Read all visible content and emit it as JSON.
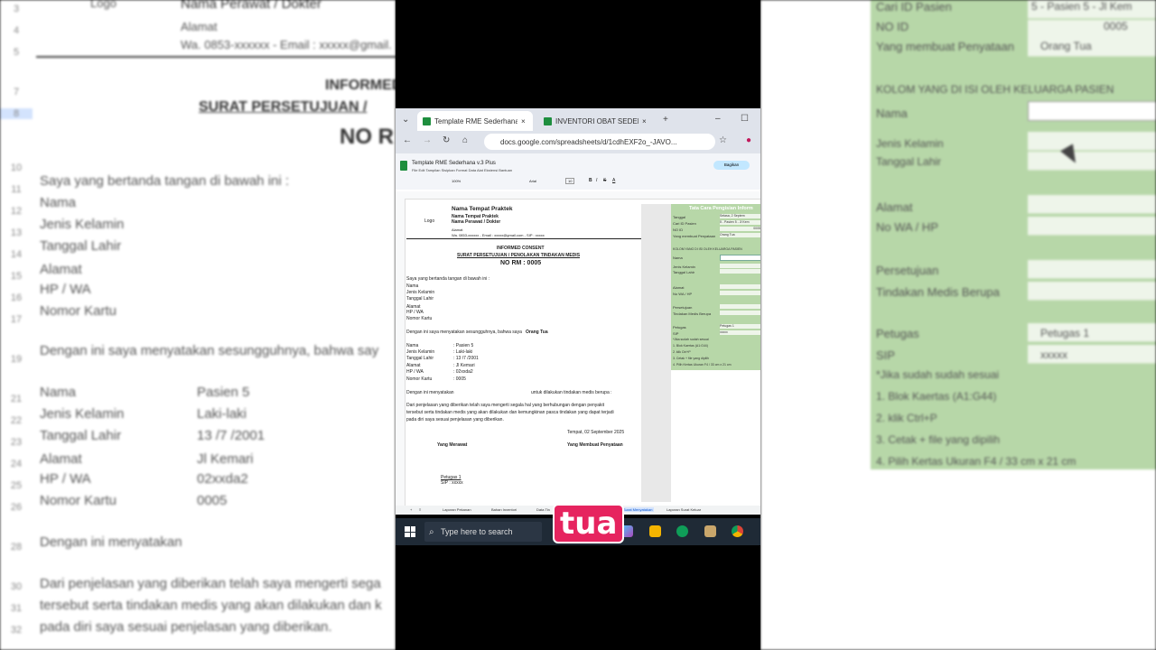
{
  "browser": {
    "tabs": [
      {
        "title": "Template RME Sederhana v.3"
      },
      {
        "title": "INVENTORI OBAT SEDERHA"
      }
    ],
    "url": "docs.google.com/spreadsheets/d/1cdhEXF2o_-JAVO..."
  },
  "sheet": {
    "doc_title": "Template RME Sederhana v.3 Plus",
    "menu": "File  Edit  Tampilan  Sisipkan  Format  Data  Alat  Ekstensi  Bantuan",
    "share_label": "Bagikan",
    "zoom": "100%",
    "font": "Arial",
    "font_size": "10",
    "header": {
      "practice_name": "Nama Tempat Praktek",
      "practice_name_2": "Nama Tempat Praktek",
      "staff": "Nama Perawat / Dokter",
      "address": "Alamat",
      "contact": "Wa. 0853-xxxxxx - Email : xxxxx@gmail.com - SIP : xxxxx",
      "logo": "Logo"
    },
    "consent": {
      "title": "INFORMED CONSENT",
      "subtitle": "SURAT PERSETUJUAN / PENOLAKAN TINDAKAN MEDIS",
      "no_rm": "NO RM : 0005",
      "signer_intro": "Saya yang bertanda tangan di bawah ini :",
      "fields": [
        "Nama",
        "Jenis Kelamin",
        "Tanggal Lahir",
        "Alamat",
        "HP / WA",
        "Nomor Kartu"
      ],
      "statement": "Dengan ini saya menyatakan sesungguhnya, bahwa saya",
      "relation": "Orang Tua",
      "patient": [
        {
          "label": "Nama",
          "value": ": Pasien 5"
        },
        {
          "label": "Jenis Kelamin",
          "value": ": Laki-laki"
        },
        {
          "label": "Tanggal Lahir",
          "value": ": 13 /7 /2001"
        },
        {
          "label": "Alamat",
          "value": ": Jl Kemari"
        },
        {
          "label": "HP / WA",
          "value": ": 02xxda2"
        },
        {
          "label": "Nomor Kartu",
          "value": ": 0005"
        }
      ],
      "declare": "Dengan ini menyatakan",
      "declare_2": "untuk dilakukan tindakan medis berupa :",
      "explanation_1": "Dari penjelasan yang diberikan telah saya mengerti segala hal yang berhubungan dengan penyakit",
      "explanation_2": "tersebut serta tindakan medis yang akan dilakukan dan kemungkinan pasca tindakan yang dapat terjadi",
      "explanation_3": "pada diri saya sesuai penjelasan yang diberikan.",
      "place_date": "Tempat, 02 September 2025",
      "sign_left": "Yang Merawat",
      "sign_right": "Yang Membuat Penyataan",
      "officer": "Petugas 1",
      "sip": "SIP : xxxxx"
    },
    "panel": {
      "title": "Tata Cara Pengisian Inform",
      "rows": [
        {
          "label": "Tanggal",
          "value": "Selasa, 2 Septem"
        },
        {
          "label": "Cari ID Pasien",
          "value": "5 - Pasien 5 - Jl Kem"
        },
        {
          "label": "NO ID",
          "value": "0005"
        },
        {
          "label": "Yang membuat Penyataan",
          "value": "Orang Tua"
        }
      ],
      "family_header": "KOLOM YANG DI ISI OLEH KELUARGA PASIEN",
      "family_fields": [
        "Nama",
        "Jenis Kelamin",
        "Tanggal Lahir",
        "Alamat",
        "No WA / HP",
        "Persetujuan",
        "Tindakan Medis Berupa"
      ],
      "officer_label": "Petugas",
      "officer_value": "Petugas 1",
      "sip_label": "SIP",
      "sip_value": "xxxxx",
      "notes": [
        "*Jika sudah sudah sesuai",
        "1. Blok Kaertas (A1:G44)",
        "2. klik Ctrl+P",
        "3. Cetak + file yang dipilih",
        "4. Pilih Kertas Ukuran F4 / 33 cm x 21 cm"
      ]
    },
    "tabs": [
      "Laporan Pekanan",
      "Bahan Inventori",
      "Data Tin",
      "Surat Menyatakan",
      "Laporan Surat Keluar"
    ]
  },
  "taskbar": {
    "search_placeholder": "Type here to search"
  },
  "caption": "tua",
  "background_left": {
    "logo": "Logo",
    "staff": "Nama Perawat / Dokter",
    "address": "Alamat",
    "contact": "Wa. 0853-xxxxxx - Email : xxxxx@gmail.",
    "title": "INFORMED",
    "subtitle": "SURAT PERSETUJUAN /",
    "no_rm": "NO R",
    "signer_intro": "Saya yang bertanda tangan di bawah ini :",
    "fields": [
      "Nama",
      "Jenis Kelamin",
      "Tanggal Lahir",
      "Alamat",
      "HP / WA",
      "Nomor Kartu"
    ],
    "statement": "Dengan ini saya menyatakan sesungguhnya, bahwa say",
    "patient": [
      {
        "label": "Nama",
        "value": "Pasien 5"
      },
      {
        "label": "Jenis Kelamin",
        "value": "Laki-laki"
      },
      {
        "label": "Tanggal Lahir",
        "value": "13 /7 /2001"
      },
      {
        "label": "Alamat",
        "value": "Jl Kemari"
      },
      {
        "label": "HP / WA",
        "value": "02xxda2"
      },
      {
        "label": "Nomor Kartu",
        "value": "0005"
      }
    ],
    "declare": "Dengan ini menyatakan",
    "explanation_1": "Dari penjelasan yang diberikan telah saya mengerti sega",
    "explanation_2": "tersebut serta tindakan medis yang akan dilakukan dan k",
    "explanation_3": "pada diri saya sesuai penjelasan yang diberikan."
  },
  "background_right": {
    "rows": [
      "Cari ID Pasien",
      "NO ID",
      "Yang membuat Penyataan"
    ],
    "values": [
      "5 - Pasien 5 - Jl Kem",
      "0005",
      "Orang Tua"
    ],
    "family_header": "KOLOM YANG DI ISI OLEH KELUARGA PASIEN",
    "family_fields": [
      "Nama",
      "Jenis Kelamin",
      "Tanggal Lahir",
      "Alamat",
      "No WA / HP",
      "Persetujuan",
      "Tindakan Medis Berupa"
    ],
    "officer_label": "Petugas",
    "officer_value": "Petugas 1",
    "sip_label": "SIP",
    "sip_value": "xxxxx",
    "notes": [
      "*Jika sudah sudah sesuai",
      "1. Blok Kaertas (A1:G44)",
      "2. klik Ctrl+P",
      "3. Cetak + file yang dipilih",
      "4. Pilih Kertas Ukuran F4 / 33 cm x 21 cm"
    ]
  }
}
